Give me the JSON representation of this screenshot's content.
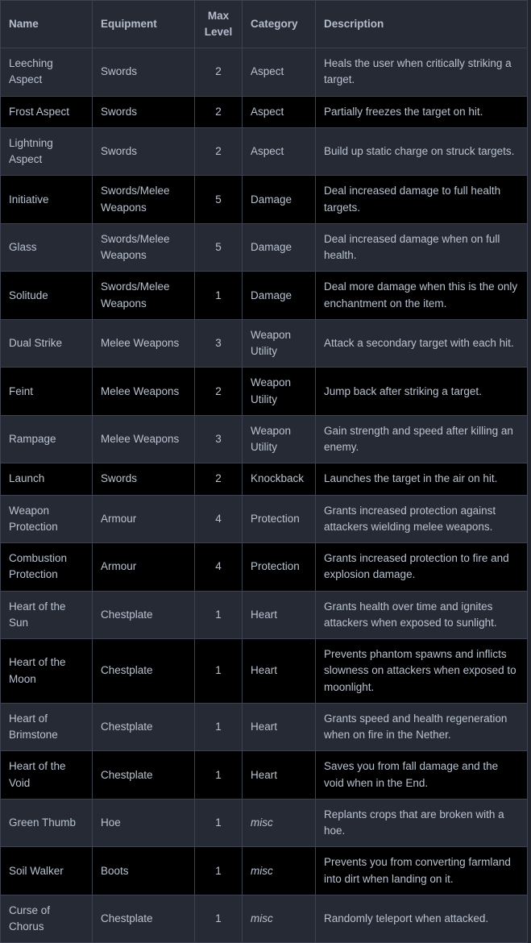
{
  "table": {
    "name": "minecraft-enchantments-table",
    "colors": {
      "row_odd_bg": "#262a35",
      "row_even_bg": "#000000",
      "header_bg": "#262a35",
      "border": "#3d4350",
      "header_text": "#b4bdcc",
      "body_text": "#b9c2d0",
      "page_bg": "#22252e"
    },
    "columns": [
      {
        "key": "name",
        "label": "Name",
        "align": "left"
      },
      {
        "key": "equipment",
        "label": "Equipment",
        "align": "left"
      },
      {
        "key": "max_level",
        "label": "Max\nLevel",
        "align": "center"
      },
      {
        "key": "category",
        "label": "Category",
        "align": "left"
      },
      {
        "key": "description",
        "label": "Description",
        "align": "left"
      }
    ],
    "header": {
      "name": "Name",
      "equipment": "Equipment",
      "max_level_line1": "Max",
      "max_level_line2": "Level",
      "category": "Category",
      "description": "Description"
    },
    "rows": [
      {
        "name": "Leeching Aspect",
        "equipment": "Swords",
        "max_level": "2",
        "category": "Aspect",
        "category_italic": false,
        "description": "Heals the user when critically striking a target."
      },
      {
        "name": "Frost Aspect",
        "equipment": "Swords",
        "max_level": "2",
        "category": "Aspect",
        "category_italic": false,
        "description": "Partially freezes the target on hit."
      },
      {
        "name": "Lightning Aspect",
        "equipment": "Swords",
        "max_level": "2",
        "category": "Aspect",
        "category_italic": false,
        "description": "Build up static charge on struck targets."
      },
      {
        "name": "Initiative",
        "equipment": "Swords/Melee Weapons",
        "max_level": "5",
        "category": "Damage",
        "category_italic": false,
        "description": "Deal increased damage to full health targets."
      },
      {
        "name": "Glass",
        "equipment": "Swords/Melee Weapons",
        "max_level": "5",
        "category": "Damage",
        "category_italic": false,
        "description": "Deal increased damage when on full health."
      },
      {
        "name": "Solitude",
        "equipment": "Swords/Melee Weapons",
        "max_level": "1",
        "category": "Damage",
        "category_italic": false,
        "description": "Deal more damage when this is the only enchantment on the item."
      },
      {
        "name": "Dual Strike",
        "equipment": "Melee Weapons",
        "max_level": "3",
        "category": "Weapon Utility",
        "category_italic": false,
        "description": "Attack a secondary target with each hit."
      },
      {
        "name": "Feint",
        "equipment": "Melee Weapons",
        "max_level": "2",
        "category": "Weapon Utility",
        "category_italic": false,
        "description": "Jump back after striking a target."
      },
      {
        "name": "Rampage",
        "equipment": "Melee Weapons",
        "max_level": "3",
        "category": "Weapon Utility",
        "category_italic": false,
        "description": "Gain strength and speed after killing an enemy."
      },
      {
        "name": "Launch",
        "equipment": "Swords",
        "max_level": "2",
        "category": "Knockback",
        "category_italic": false,
        "description": "Launches the target in the air on hit."
      },
      {
        "name": "Weapon Protection",
        "equipment": "Armour",
        "max_level": "4",
        "category": "Protection",
        "category_italic": false,
        "description": "Grants increased protection against attackers wielding melee weapons."
      },
      {
        "name": "Combustion Protection",
        "equipment": "Armour",
        "max_level": "4",
        "category": "Protection",
        "category_italic": false,
        "description": "Grants increased protection to fire and explosion damage."
      },
      {
        "name": "Heart of the Sun",
        "equipment": "Chestplate",
        "max_level": "1",
        "category": "Heart",
        "category_italic": false,
        "description": "Grants health over time and ignites attackers when exposed to sunlight."
      },
      {
        "name": "Heart of the Moon",
        "equipment": "Chestplate",
        "max_level": "1",
        "category": "Heart",
        "category_italic": false,
        "description": "Prevents phantom spawns and inflicts slowness on attackers when exposed to moonlight."
      },
      {
        "name": "Heart of Brimstone",
        "equipment": "Chestplate",
        "max_level": "1",
        "category": "Heart",
        "category_italic": false,
        "description": "Grants speed and health regeneration when on fire in the Nether."
      },
      {
        "name": "Heart of the Void",
        "equipment": "Chestplate",
        "max_level": "1",
        "category": "Heart",
        "category_italic": false,
        "description": "Saves you from fall damage and the void when in the End."
      },
      {
        "name": "Green Thumb",
        "equipment": "Hoe",
        "max_level": "1",
        "category": "misc",
        "category_italic": true,
        "description": "Replants crops that are broken with a hoe."
      },
      {
        "name": "Soil Walker",
        "equipment": "Boots",
        "max_level": "1",
        "category": "misc",
        "category_italic": true,
        "description": "Prevents you from converting farmland into dirt when landing on it."
      },
      {
        "name": "Curse of Chorus",
        "equipment": "Chestplate",
        "max_level": "1",
        "category": "misc",
        "category_italic": true,
        "description": "Randomly teleport when attacked."
      }
    ]
  }
}
